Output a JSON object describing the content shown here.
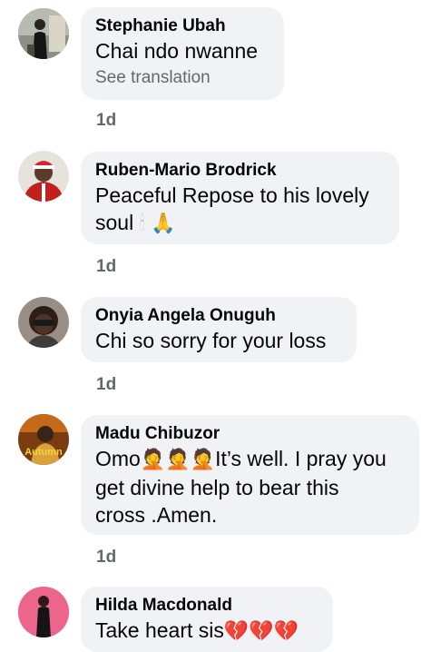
{
  "comments": [
    {
      "name": "Stephanie Ubah",
      "text": "Chai ndo nwanne",
      "translation_link": "See translation",
      "time": "1d"
    },
    {
      "name": "Ruben-Mario Brodrick",
      "text_line1": "Peaceful Repose to his lovely",
      "text_line2": "soul",
      "emoji_candle": "🕯",
      "emoji_pray": "🙏",
      "time": "1d"
    },
    {
      "name": "Onyia Angela Onuguh",
      "text": "Chi so sorry for your loss",
      "time": "1d"
    },
    {
      "name": "Madu Chibuzor",
      "text_prefix": "Omo",
      "emoji_person": "🤦",
      "text_after": "It’s well. I pray you",
      "text_line2": "get divine help to bear this",
      "text_line3": "cross .Amen.",
      "avatar_text": "Autumn",
      "time": "1d"
    },
    {
      "name": "Hilda Macdonald",
      "text": "Take heart sis",
      "emoji_heart": "💔"
    }
  ]
}
